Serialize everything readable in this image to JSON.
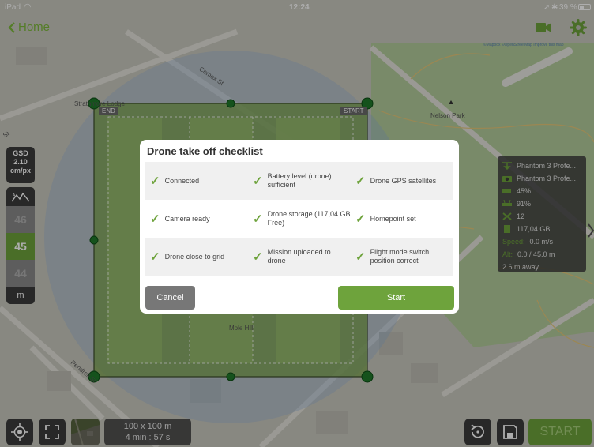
{
  "status_bar": {
    "device": "iPad",
    "time": "12:24",
    "battery": "39 %"
  },
  "nav": {
    "back_label": "Home",
    "camera_icon": "video-camera-icon",
    "settings_icon": "gear-icon"
  },
  "map": {
    "attribution": "©Mapbox ©OpenStreetMap Improve this map",
    "labels": {
      "comox": "Comox St",
      "strathmore": "Strathmore Lodge",
      "nelson_park": "Nelson Park",
      "mole_hill": "Mole Hill",
      "pendrell": "Pendrell St",
      "st": "St"
    },
    "corner_end": "END",
    "corner_start": "START"
  },
  "gsd": {
    "label": "GSD",
    "value": "2.10",
    "unit": "cm/px"
  },
  "altitude": {
    "above": "46",
    "current": "45",
    "below": "44",
    "unit": "m"
  },
  "telemetry": {
    "aircraft": "Phantom 3 Profe...",
    "camera": "Phantom 3 Profe...",
    "battery": "45%",
    "signal": "91%",
    "satellites": "12",
    "storage": "117,04 GB",
    "speed_label": "Speed:",
    "speed": "0.0 m/s",
    "alt_label": "Alt:",
    "alt": "0.0 / 45.0 m",
    "distance": "2.6 m away"
  },
  "bottom": {
    "grid_size": "100 x 100 m",
    "duration": "4 min : 57 s",
    "start_label": "START"
  },
  "modal": {
    "title": "Drone take off checklist",
    "rows": [
      [
        "Connected",
        "Battery level (drone) sufficient",
        "Drone GPS satellites"
      ],
      [
        "Camera ready",
        "Drone storage (117,04 GB Free)",
        "Homepoint set"
      ],
      [
        "Drone close to grid",
        "Mission uploaded to drone",
        "Flight mode switch position correct"
      ]
    ],
    "cancel_label": "Cancel",
    "start_label": "Start"
  },
  "colors": {
    "accent": "#6ea33c",
    "panel": "#3c3c3c"
  }
}
